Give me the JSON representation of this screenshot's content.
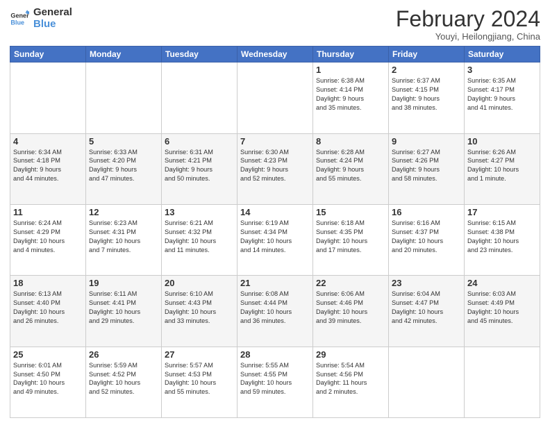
{
  "logo": {
    "line1": "General",
    "line2": "Blue"
  },
  "title": "February 2024",
  "subtitle": "Youyi, Heilongjiang, China",
  "days_of_week": [
    "Sunday",
    "Monday",
    "Tuesday",
    "Wednesday",
    "Thursday",
    "Friday",
    "Saturday"
  ],
  "weeks": [
    [
      {
        "day": "",
        "info": ""
      },
      {
        "day": "",
        "info": ""
      },
      {
        "day": "",
        "info": ""
      },
      {
        "day": "",
        "info": ""
      },
      {
        "day": "1",
        "info": "Sunrise: 6:38 AM\nSunset: 4:14 PM\nDaylight: 9 hours\nand 35 minutes."
      },
      {
        "day": "2",
        "info": "Sunrise: 6:37 AM\nSunset: 4:15 PM\nDaylight: 9 hours\nand 38 minutes."
      },
      {
        "day": "3",
        "info": "Sunrise: 6:35 AM\nSunset: 4:17 PM\nDaylight: 9 hours\nand 41 minutes."
      }
    ],
    [
      {
        "day": "4",
        "info": "Sunrise: 6:34 AM\nSunset: 4:18 PM\nDaylight: 9 hours\nand 44 minutes."
      },
      {
        "day": "5",
        "info": "Sunrise: 6:33 AM\nSunset: 4:20 PM\nDaylight: 9 hours\nand 47 minutes."
      },
      {
        "day": "6",
        "info": "Sunrise: 6:31 AM\nSunset: 4:21 PM\nDaylight: 9 hours\nand 50 minutes."
      },
      {
        "day": "7",
        "info": "Sunrise: 6:30 AM\nSunset: 4:23 PM\nDaylight: 9 hours\nand 52 minutes."
      },
      {
        "day": "8",
        "info": "Sunrise: 6:28 AM\nSunset: 4:24 PM\nDaylight: 9 hours\nand 55 minutes."
      },
      {
        "day": "9",
        "info": "Sunrise: 6:27 AM\nSunset: 4:26 PM\nDaylight: 9 hours\nand 58 minutes."
      },
      {
        "day": "10",
        "info": "Sunrise: 6:26 AM\nSunset: 4:27 PM\nDaylight: 10 hours\nand 1 minute."
      }
    ],
    [
      {
        "day": "11",
        "info": "Sunrise: 6:24 AM\nSunset: 4:29 PM\nDaylight: 10 hours\nand 4 minutes."
      },
      {
        "day": "12",
        "info": "Sunrise: 6:23 AM\nSunset: 4:31 PM\nDaylight: 10 hours\nand 7 minutes."
      },
      {
        "day": "13",
        "info": "Sunrise: 6:21 AM\nSunset: 4:32 PM\nDaylight: 10 hours\nand 11 minutes."
      },
      {
        "day": "14",
        "info": "Sunrise: 6:19 AM\nSunset: 4:34 PM\nDaylight: 10 hours\nand 14 minutes."
      },
      {
        "day": "15",
        "info": "Sunrise: 6:18 AM\nSunset: 4:35 PM\nDaylight: 10 hours\nand 17 minutes."
      },
      {
        "day": "16",
        "info": "Sunrise: 6:16 AM\nSunset: 4:37 PM\nDaylight: 10 hours\nand 20 minutes."
      },
      {
        "day": "17",
        "info": "Sunrise: 6:15 AM\nSunset: 4:38 PM\nDaylight: 10 hours\nand 23 minutes."
      }
    ],
    [
      {
        "day": "18",
        "info": "Sunrise: 6:13 AM\nSunset: 4:40 PM\nDaylight: 10 hours\nand 26 minutes."
      },
      {
        "day": "19",
        "info": "Sunrise: 6:11 AM\nSunset: 4:41 PM\nDaylight: 10 hours\nand 29 minutes."
      },
      {
        "day": "20",
        "info": "Sunrise: 6:10 AM\nSunset: 4:43 PM\nDaylight: 10 hours\nand 33 minutes."
      },
      {
        "day": "21",
        "info": "Sunrise: 6:08 AM\nSunset: 4:44 PM\nDaylight: 10 hours\nand 36 minutes."
      },
      {
        "day": "22",
        "info": "Sunrise: 6:06 AM\nSunset: 4:46 PM\nDaylight: 10 hours\nand 39 minutes."
      },
      {
        "day": "23",
        "info": "Sunrise: 6:04 AM\nSunset: 4:47 PM\nDaylight: 10 hours\nand 42 minutes."
      },
      {
        "day": "24",
        "info": "Sunrise: 6:03 AM\nSunset: 4:49 PM\nDaylight: 10 hours\nand 45 minutes."
      }
    ],
    [
      {
        "day": "25",
        "info": "Sunrise: 6:01 AM\nSunset: 4:50 PM\nDaylight: 10 hours\nand 49 minutes."
      },
      {
        "day": "26",
        "info": "Sunrise: 5:59 AM\nSunset: 4:52 PM\nDaylight: 10 hours\nand 52 minutes."
      },
      {
        "day": "27",
        "info": "Sunrise: 5:57 AM\nSunset: 4:53 PM\nDaylight: 10 hours\nand 55 minutes."
      },
      {
        "day": "28",
        "info": "Sunrise: 5:55 AM\nSunset: 4:55 PM\nDaylight: 10 hours\nand 59 minutes."
      },
      {
        "day": "29",
        "info": "Sunrise: 5:54 AM\nSunset: 4:56 PM\nDaylight: 11 hours\nand 2 minutes."
      },
      {
        "day": "",
        "info": ""
      },
      {
        "day": "",
        "info": ""
      }
    ]
  ]
}
